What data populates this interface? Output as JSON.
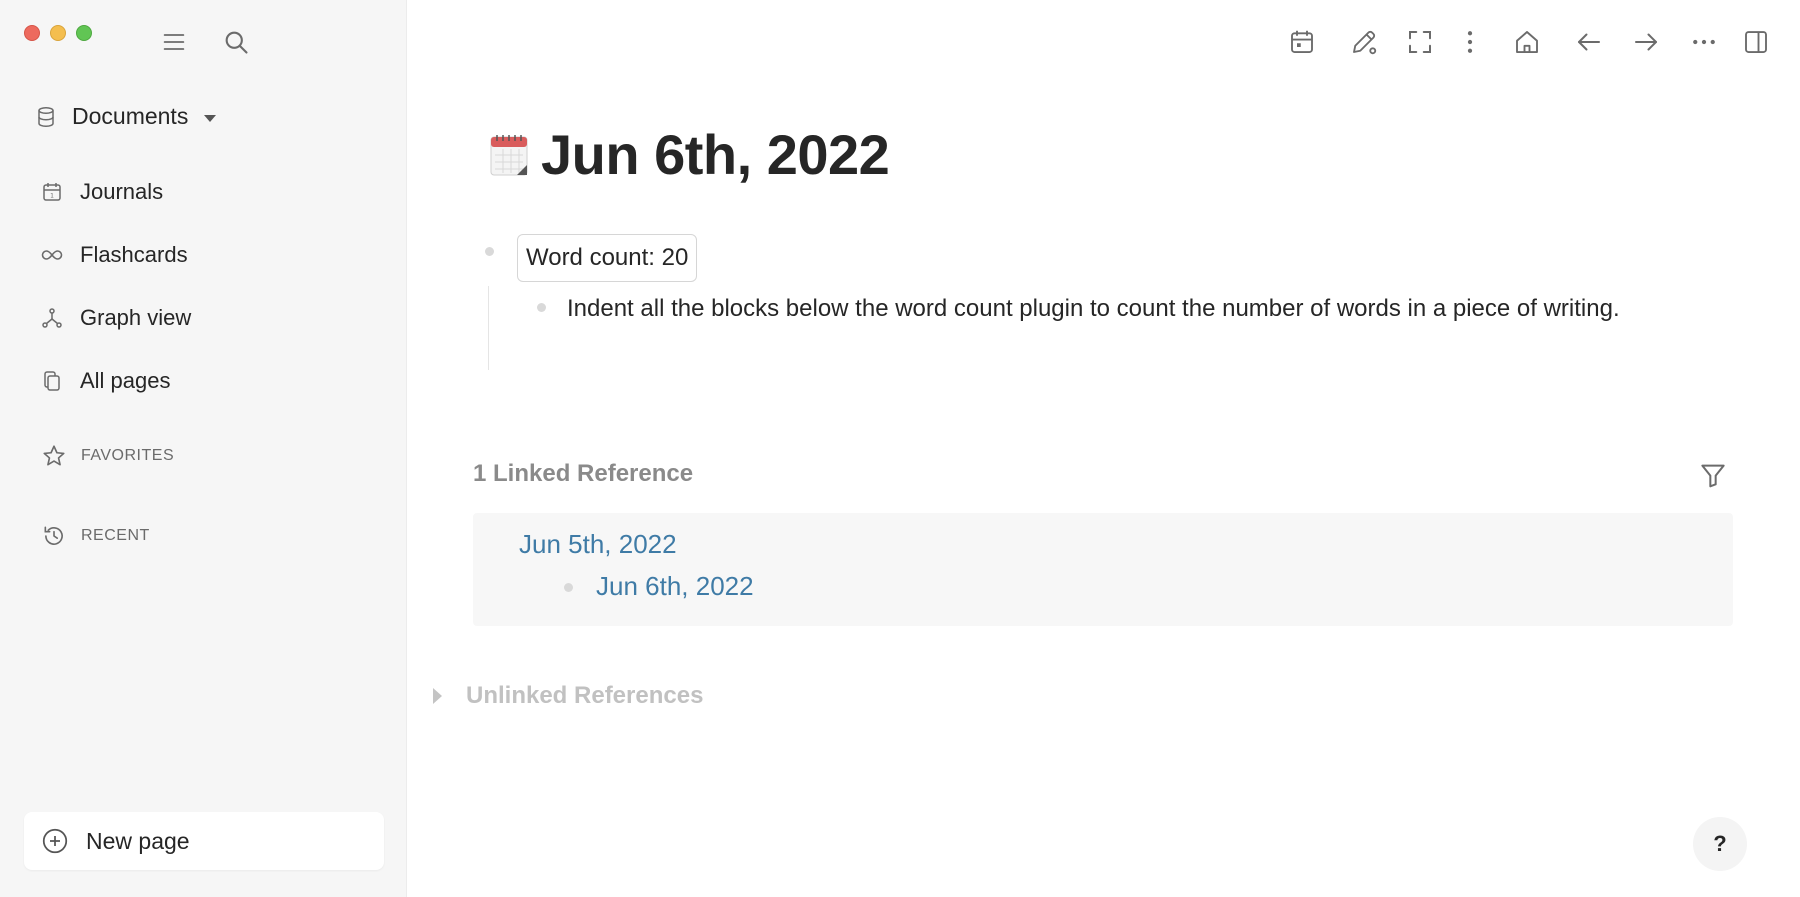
{
  "window": {
    "traffic_lights": [
      "close",
      "minimize",
      "zoom"
    ]
  },
  "sidebar": {
    "top_icons": [
      "menu-icon",
      "search-icon"
    ],
    "graph_name": "Documents",
    "nav_items": [
      {
        "label": "Journals",
        "icon": "calendar-icon"
      },
      {
        "label": "Flashcards",
        "icon": "infinity-icon"
      },
      {
        "label": "Graph view",
        "icon": "graph-icon"
      },
      {
        "label": "All pages",
        "icon": "pages-icon"
      }
    ],
    "favorites_label": "FAVORITES",
    "recent_label": "RECENT",
    "new_page_label": "New page"
  },
  "toolbar": {
    "icons": [
      "calendar-icon",
      "pencil-icon",
      "fullscreen-icon",
      "more-vertical-icon",
      "home-icon",
      "back-arrow-icon",
      "forward-arrow-icon",
      "more-horizontal-icon",
      "right-sidebar-icon"
    ]
  },
  "page": {
    "title": "Jun 6th, 2022",
    "emoji": "calendar-emoji",
    "blocks": [
      {
        "text": "Word count: 20"
      },
      {
        "text": "Indent all the blocks below the word count plugin to count the number of words in a piece of writing."
      }
    ]
  },
  "references": {
    "linked_header": "1 Linked Reference",
    "linked_items": [
      {
        "page": "Jun 5th, 2022",
        "child": "Jun 6th, 2022"
      }
    ],
    "unlinked_header": "Unlinked References"
  },
  "help_label": "?",
  "colors": {
    "link": "#3f7ba6",
    "sidebar_bg": "#f6f6f6",
    "ref_bg": "#f7f7f7"
  }
}
